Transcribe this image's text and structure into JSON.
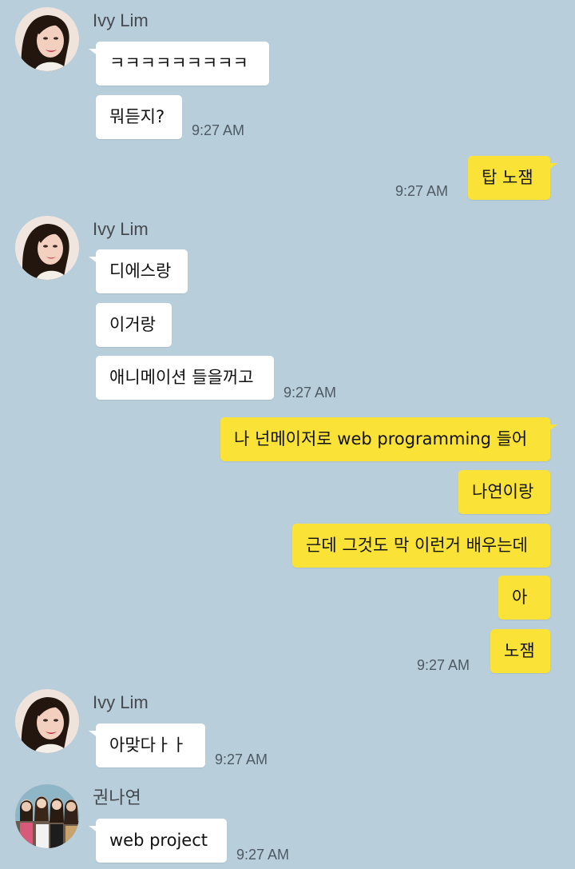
{
  "messages": {
    "g1": {
      "sender": "Ivy Lim",
      "lines": [
        "ㅋㅋㅋㅋㅋㅋㅋㅋㅋ",
        "뭐듣지?"
      ],
      "time": "9:27 AM"
    },
    "g2": {
      "lines": [
        "탑 노잼"
      ],
      "time": "9:27 AM"
    },
    "g3": {
      "sender": "Ivy Lim",
      "lines": [
        "디에스랑",
        "이거랑",
        "애니메이션 들을꺼고"
      ],
      "time": "9:27 AM"
    },
    "g4": {
      "lines": [
        "나 넌메이저로 web programming 들어",
        "나연이랑",
        "근데 그것도 막 이런거 배우는데",
        "아",
        "노잼"
      ],
      "time": "9:27 AM"
    },
    "g5": {
      "sender": "Ivy Lim",
      "lines": [
        "아맞다ㅏㅏ"
      ],
      "time": "9:27 AM"
    },
    "g6": {
      "sender": "권나연",
      "lines": [
        "web project"
      ],
      "time": "9:27 AM"
    }
  },
  "icons": {
    "ivy_avatar": "ivy-lim-avatar",
    "nayeon_avatar": "group-photo-avatar"
  },
  "colors": {
    "background": "#b9cedb",
    "incoming_bubble": "#ffffff",
    "outgoing_bubble": "#fbe236"
  }
}
